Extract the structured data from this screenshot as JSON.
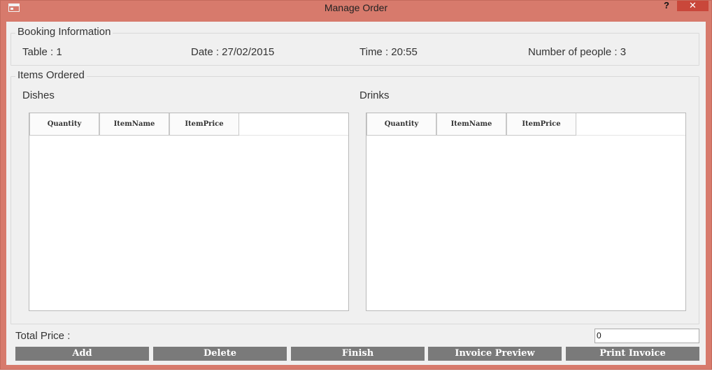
{
  "window": {
    "title": "Manage Order",
    "help_label": "?",
    "close_label": "✕",
    "icon": "app-window-icon"
  },
  "booking": {
    "legend": "Booking Information",
    "table": "Table : 1",
    "date": "Date : 27/02/2015",
    "time": "Time : 20:55",
    "people": "Number of people : 3"
  },
  "items": {
    "legend": "Items Ordered",
    "dishes": {
      "label": "Dishes",
      "columns": [
        "Quantity",
        "ItemName",
        "ItemPrice"
      ],
      "rows": []
    },
    "drinks": {
      "label": "Drinks",
      "columns": [
        "Quantity",
        "ItemName",
        "ItemPrice"
      ],
      "rows": []
    }
  },
  "total": {
    "label": "Total Price :",
    "value": "0"
  },
  "buttons": {
    "add": "Add",
    "delete": "Delete",
    "finish": "Finish",
    "invoice_preview": "Invoice Preview",
    "print_invoice": "Print Invoice"
  },
  "colors": {
    "window_frame": "#d77a6c",
    "close_button": "#c9473a",
    "action_button": "#7a7a7a",
    "client_background": "#f0f0f0"
  }
}
